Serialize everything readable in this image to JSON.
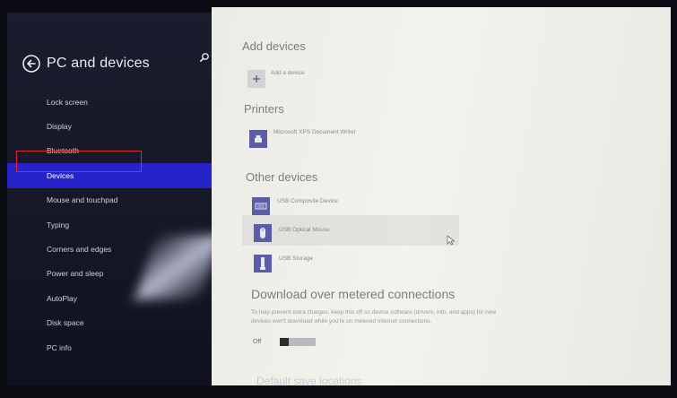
{
  "header": {
    "title": "PC and devices",
    "back_icon": "back-arrow-icon",
    "search_icon": "search-icon"
  },
  "sidebar": {
    "items": [
      {
        "label": "Lock screen"
      },
      {
        "label": "Display"
      },
      {
        "label": "Bluetooth"
      },
      {
        "label": "Devices",
        "selected": true
      },
      {
        "label": "Mouse and touchpad"
      },
      {
        "label": "Typing"
      },
      {
        "label": "Corners and edges"
      },
      {
        "label": "Power and sleep"
      },
      {
        "label": "AutoPlay"
      },
      {
        "label": "Disk space"
      },
      {
        "label": "PC info"
      }
    ]
  },
  "add_devices": {
    "title": "Add devices",
    "add_label": "Add a device"
  },
  "printers": {
    "title": "Printers",
    "items": [
      {
        "label": "Microsoft XPS Document Writer"
      }
    ]
  },
  "other_devices": {
    "title": "Other devices",
    "items": [
      {
        "label": "USB Composite Device"
      },
      {
        "label": "USB Optical Mouse"
      },
      {
        "label": "USB Storage"
      }
    ]
  },
  "metered": {
    "title": "Download over metered connections",
    "description_line1": "To help prevent extra charges, keep this off so device software (drivers, info, and apps) for new",
    "description_line2": "devices won't download while you're on metered Internet connections.",
    "toggle_label": "Off",
    "toggle_on": false
  },
  "default_apps": {
    "title": "Default save locations"
  },
  "colors": {
    "accent": "#2623c9",
    "device_tile": "#5c5ca8",
    "sidebar_bg": "#171929",
    "content_bg": "#efeeea",
    "highlight": "#e0282a"
  }
}
